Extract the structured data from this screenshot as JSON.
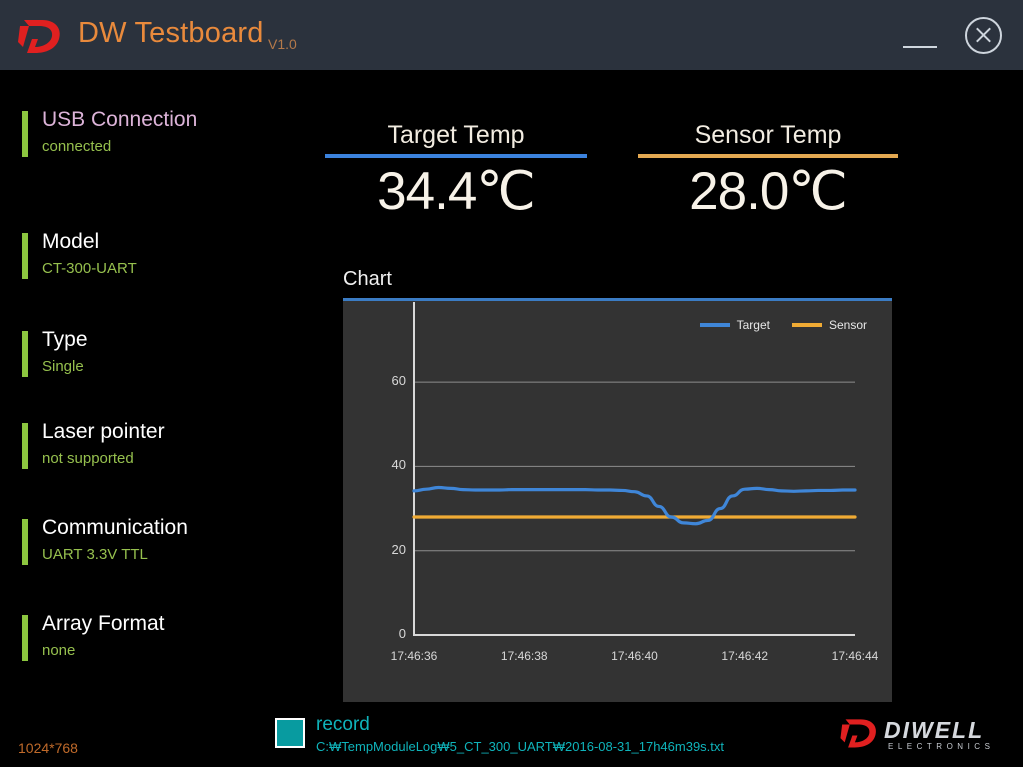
{
  "window": {
    "title": "DW Testboard",
    "version": "V1.0",
    "logo_icon": "diwell-d-logo-icon",
    "minimize_label": "minimize-icon",
    "close_label": "close-icon"
  },
  "sidebar": {
    "items": [
      {
        "label": "USB Connection",
        "value": "connected",
        "highlight": true
      },
      {
        "label": "Model",
        "value": "CT-300-UART",
        "highlight": false
      },
      {
        "label": "Type",
        "value": "Single",
        "highlight": false
      },
      {
        "label": "Laser pointer",
        "value": "not supported",
        "highlight": false
      },
      {
        "label": "Communication",
        "value": "UART 3.3V TTL",
        "highlight": false
      },
      {
        "label": "Array Format",
        "value": "none",
        "highlight": false
      }
    ]
  },
  "readouts": {
    "target": {
      "title": "Target Temp",
      "value": "34.4℃",
      "color": "#3b82dd"
    },
    "sensor": {
      "title": "Sensor Temp",
      "value": "28.0℃",
      "color": "#e3a851"
    }
  },
  "chart_panel": {
    "title": "Chart"
  },
  "chart_data": {
    "type": "line",
    "title": "Chart",
    "xlabel": "",
    "ylabel": "",
    "ylim": [
      0,
      70
    ],
    "yticks": [
      0,
      20,
      40,
      60
    ],
    "grid": true,
    "legend_position": "top-right",
    "x": [
      "17:46:36",
      "17:46:38",
      "17:46:40",
      "17:46:42",
      "17:46:44"
    ],
    "xticks": [
      "17:46:36",
      "17:46:38",
      "17:46:40",
      "17:46:42",
      "17:46:44"
    ],
    "series": [
      {
        "name": "Target",
        "color": "#3f86d8",
        "values": [
          34.2,
          34.6,
          35.0,
          34.8,
          34.5,
          34.4,
          34.4,
          34.4,
          34.5,
          34.5,
          34.5,
          34.5,
          34.5,
          34.5,
          34.5,
          34.4,
          34.4,
          34.3,
          34.0,
          33.0,
          30.5,
          28.0,
          26.6,
          26.4,
          27.2,
          30.0,
          33.0,
          34.6,
          34.8,
          34.5,
          34.2,
          34.1,
          34.2,
          34.3,
          34.3,
          34.4,
          34.4
        ]
      },
      {
        "name": "Sensor",
        "color": "#f0ab34",
        "values": [
          28.0,
          28.0,
          28.0,
          28.0,
          28.0,
          28.0,
          28.0,
          28.0,
          28.0,
          28.0,
          28.0,
          28.0,
          28.0,
          28.0,
          28.0,
          28.0,
          28.0,
          28.0,
          28.0,
          28.0,
          28.0,
          28.0,
          28.0,
          28.0,
          28.0,
          28.0,
          28.0,
          28.0,
          28.0,
          28.0,
          28.0,
          28.0,
          28.0,
          28.0,
          28.0,
          28.0,
          28.0
        ]
      }
    ]
  },
  "footer": {
    "record_label": "record",
    "record_path": "C:₩TempModuleLog₩5_CT_300_UART₩2016-08-31_17h46m39s.txt",
    "resolution": "1024*768",
    "brand_name": "DIWELL",
    "brand_sub": "ELECTRONICS",
    "brand_icon": "diwell-d-logo-icon"
  }
}
